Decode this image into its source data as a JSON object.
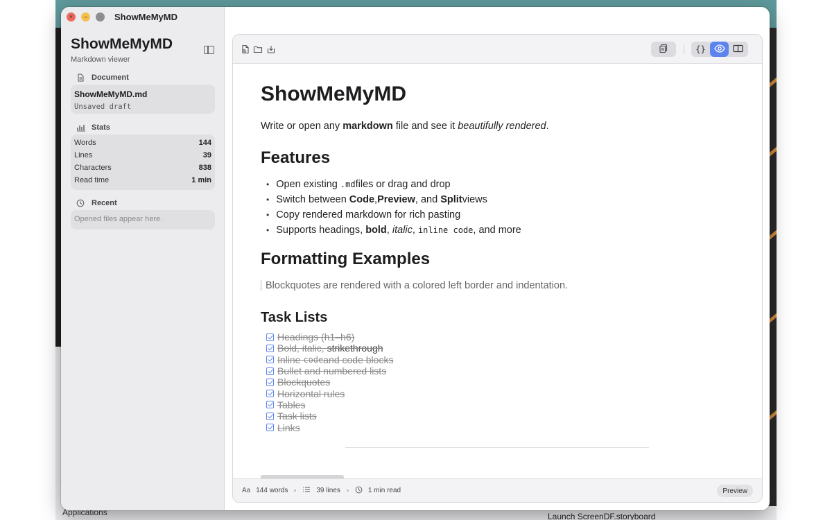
{
  "window": {
    "title": "ShowMeMyMD"
  },
  "sidebar": {
    "app_name": "ShowMeMyMD",
    "app_subtitle": "Markdown viewer",
    "document_section": "Document",
    "document": {
      "name": "ShowMeMyMD.md",
      "status": "Unsaved draft"
    },
    "stats_section": "Stats",
    "stats": [
      {
        "label": "Words",
        "value": "144"
      },
      {
        "label": "Lines",
        "value": "39"
      },
      {
        "label": "Characters",
        "value": "838"
      },
      {
        "label": "Read time",
        "value": "1 min"
      }
    ],
    "recent_section": "Recent",
    "recent_empty": "Opened files appear here."
  },
  "toolbar": {
    "icons": [
      "new-file-icon",
      "open-folder-icon",
      "save-icon",
      "copy-icon",
      "code-view-icon",
      "preview-view-icon",
      "split-view-icon"
    ],
    "active_mode": "preview",
    "accent": "#5d84ee"
  },
  "doc": {
    "title": "ShowMeMyMD",
    "intro": {
      "part1": "Write or open any ",
      "bold": "markdown",
      "part2": " file and see it ",
      "italic": "beautifully rendered",
      "part3": "."
    },
    "features_heading": "Features",
    "features": {
      "f1a": "Open existing ",
      "f1code": ".md",
      "f1b": " files or drag and drop",
      "f2a": "Switch between ",
      "f2b1": "Code",
      "f2c": ", ",
      "f2b2": "Preview",
      "f2d": ", and ",
      "f2b3": "Split",
      "f2e": " views",
      "f3": "Copy rendered markdown for rich pasting",
      "f4a": "Supports headings, ",
      "f4bold": "bold",
      "f4c": ", ",
      "f4italic": "italic",
      "f4d": ", ",
      "f4code": "inline code",
      "f4e": ", and more"
    },
    "formatting_heading": "Formatting Examples",
    "blockquote": "Blockquotes are rendered with a colored left border and indentation.",
    "tasks_heading": "Task Lists",
    "tasks": {
      "t1": "Headings (h1–h6)",
      "t2a": "Bold, italic, ",
      "t2b": "strikethrough",
      "t3a": "Inline ",
      "t3code": "code",
      "t3b": " and code blocks",
      "t4": "Bullet and numbered lists",
      "t5": "Blockquotes",
      "t6": "Horizontal rules",
      "t7": "Tables",
      "t8": "Task lists",
      "t9": "Links"
    }
  },
  "statusbar": {
    "font_icon": "Aa",
    "words": "144 words",
    "lines": "39 lines",
    "read": "1 min read",
    "mode": "Preview"
  },
  "desktop": {
    "apps_label": "Applications",
    "file_label": "Launch ScreenDF.storyboard"
  }
}
